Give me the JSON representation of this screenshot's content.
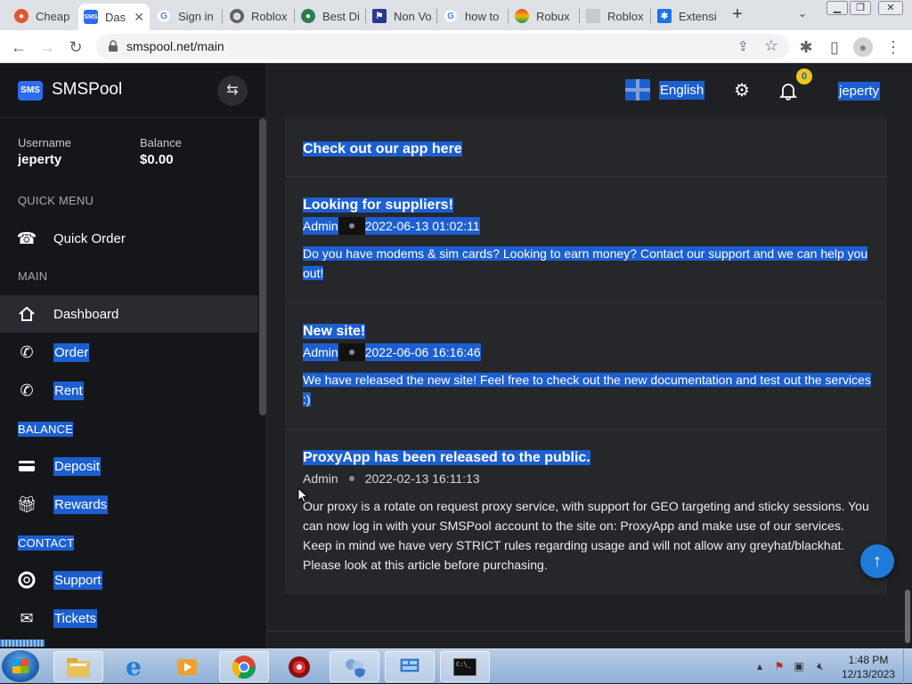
{
  "browser": {
    "tabs": [
      {
        "title": "Cheap",
        "favicon_color": "#e2562f",
        "favicon_glyph": "reddit"
      },
      {
        "title": "Das",
        "favicon_color": "#2f6cf4",
        "favicon_glyph": "SMS",
        "active": true
      },
      {
        "title": "Sign in",
        "favicon_color": "#4285f4",
        "favicon_glyph": "google"
      },
      {
        "title": "Roblox",
        "favicon_color": "#5f6368",
        "favicon_glyph": "globe"
      },
      {
        "title": "Best Di",
        "favicon_color": "#2e7d4f",
        "favicon_glyph": "circle"
      },
      {
        "title": "Non Vo",
        "favicon_color": "#2a3a8a",
        "favicon_glyph": "flag"
      },
      {
        "title": "how to",
        "favicon_color": "#4285f4",
        "favicon_glyph": "google"
      },
      {
        "title": "Robux",
        "favicon_color": "#e04a3a",
        "favicon_glyph": "rainbow"
      },
      {
        "title": "Roblox",
        "favicon_color": "#9aa0a6",
        "favicon_glyph": "page"
      },
      {
        "title": "Extensi",
        "favicon_color": "#1a73e8",
        "favicon_glyph": "puzzle"
      }
    ],
    "url": "smspool.net/main"
  },
  "site": {
    "brand_name": "SMSPool",
    "logo_text": "SMS",
    "user": {
      "username_label": "Username",
      "username": "jeperty",
      "balance_label": "Balance",
      "balance": "$0.00"
    },
    "sections": {
      "quick_menu": "QUICK MENU",
      "main": "MAIN",
      "balance": "BALANCE",
      "contact": "CONTACT"
    },
    "nav": {
      "quick_order": "Quick Order",
      "dashboard": "Dashboard",
      "order": "Order",
      "rent": "Rent",
      "deposit": "Deposit",
      "rewards": "Rewards",
      "support": "Support",
      "tickets": "Tickets"
    },
    "topbar": {
      "language": "English",
      "notification_count": "0",
      "username": "jeperty"
    },
    "announcements": [
      {
        "title": "Check out our app here"
      },
      {
        "title": "Looking for suppliers!",
        "author": "Admin",
        "date": "2022-06-13 01:02:11",
        "body": "Do you have modems & sim cards? Looking to earn money? Contact our support and we can help you out!"
      },
      {
        "title": "New site!",
        "author": "Admin",
        "date": "2022-06-06 16:16:46",
        "body": "We have released the new site! Feel free to check out the new documentation and test out the services :)"
      },
      {
        "title": "ProxyApp has been released to the public.",
        "author": "Admin",
        "date": "2022-02-13 16:11:13",
        "body": "Our proxy is a rotate on request proxy service, with support for GEO targeting and sticky sessions. You can now log in with your SMSPool account to the site on: ProxyApp and make use of our services. Keep in mind we have very STRICT rules regarding usage and will not allow any greyhat/blackhat. Please look at this article before purchasing."
      }
    ]
  },
  "taskbar": {
    "time": "1:48 PM",
    "date": "12/13/2023"
  },
  "colors": {
    "selection": "#1c5fd1",
    "sidebar_bg": "#15161a",
    "content_bg": "#26272b",
    "accent": "#1f7bd9"
  }
}
